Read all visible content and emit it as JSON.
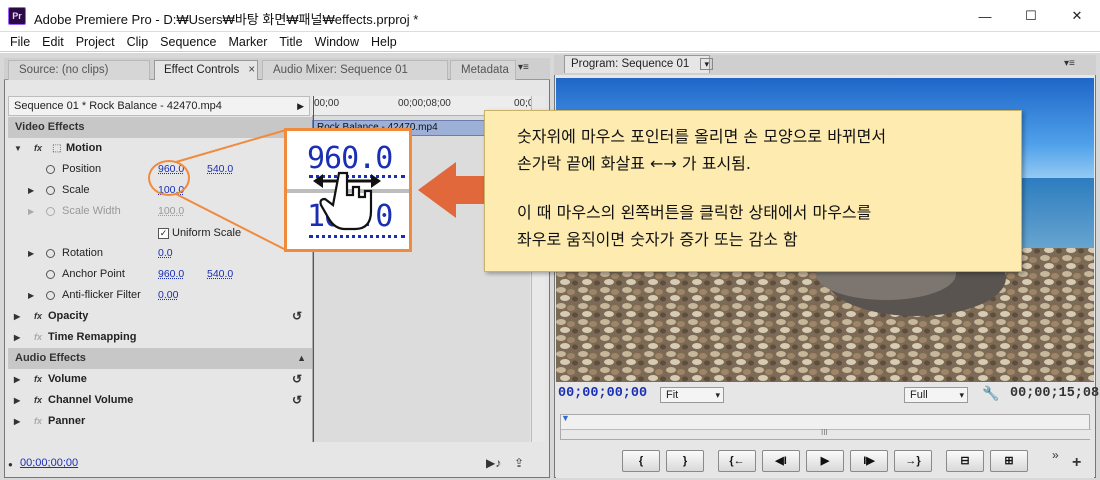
{
  "window": {
    "icon": "Pr",
    "title": "Adobe Premiere Pro - D:₩Users₩바탕 화면₩패널₩effects.prproj *",
    "controls": {
      "minimize": "—",
      "maximize": "☐",
      "close": "✕"
    }
  },
  "menu": [
    "File",
    "Edit",
    "Project",
    "Clip",
    "Sequence",
    "Marker",
    "Title",
    "Window",
    "Help"
  ],
  "left_panel": {
    "tabs": [
      "Source: (no clips)",
      "Effect Controls",
      "Audio Mixer: Sequence 01",
      "Metadata"
    ],
    "active_tab": "Effect Controls",
    "tab_close": "×",
    "menu_icon": "▾≡",
    "sequence_header": "Sequence 01 * Rock Balance - 42470.mp4",
    "ruler": {
      "start": "00;00",
      "mid": "00;00;08;00",
      "end": "00;0"
    },
    "clip_name": "Rock Balance - 42470.mp4",
    "video_effects_label": "Video Effects",
    "motion_label": "Motion",
    "position_label": "Position",
    "position_x": "960.0",
    "position_y": "540.0",
    "scale_label": "Scale",
    "scale_value": "100.0",
    "scale_width_label": "Scale Width",
    "scale_width_value": "100.0",
    "uniform_scale_label": "Uniform Scale",
    "rotation_label": "Rotation",
    "rotation_value": "0.0",
    "anchor_label": "Anchor Point",
    "anchor_x": "960.0",
    "anchor_y": "540.0",
    "antiflicker_label": "Anti-flicker Filter",
    "antiflicker_value": "0.00",
    "opacity_label": "Opacity",
    "time_remap_label": "Time Remapping",
    "audio_effects_label": "Audio Effects",
    "volume_label": "Volume",
    "channel_volume_label": "Channel Volume",
    "panner_label": "Panner",
    "footer_timecode": "00;00;00;00"
  },
  "program_monitor": {
    "tab": "Program: Sequence 01",
    "current_timecode": "00;00;00;00",
    "zoom": "Fit",
    "quality": "Full",
    "duration": "00;00;15;08",
    "buttons": [
      "{",
      "}",
      "{←",
      "◀I",
      "▶",
      "I▶",
      "→}",
      "lift",
      "extract"
    ]
  },
  "zoom_inset": {
    "top_value": "960.0",
    "bottom_value": "100.0"
  },
  "callout": {
    "line1": "숫자위에 마우스 포인터를 올리면 손 모양으로 바뀌면서",
    "line2": "손가락 끝에 화살표 ←→ 가 표시됨.",
    "line3": "이 때 마우스의 왼쪽버튼을 클릭한 상태에서 마우스를",
    "line4": "좌우로 움직이면 숫자가 증가 또는 감소 함"
  },
  "colors": {
    "accent_orange": "#f08a3c",
    "value_blue": "#1a2fb4",
    "callout_bg": "#fdebb0",
    "playhead": "#d62020"
  }
}
